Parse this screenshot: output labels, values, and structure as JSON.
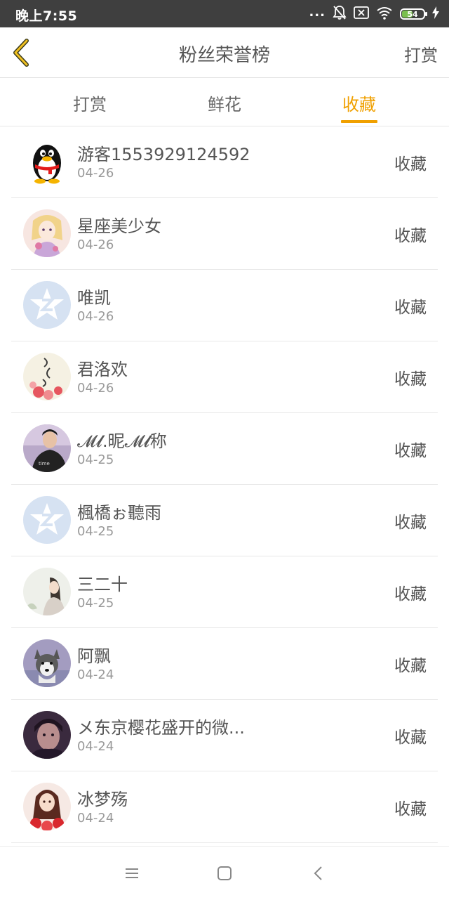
{
  "status_bar": {
    "time": "晚上7:55",
    "dots": "...",
    "battery_level": "54",
    "battery_percent": 54,
    "icons": [
      "bell-off-icon",
      "sim-x-icon",
      "wifi-icon",
      "battery-icon",
      "charging-icon"
    ]
  },
  "header": {
    "title": "粉丝荣誉榜",
    "right_action": "打赏",
    "back_icon": "chevron-left-icon"
  },
  "tabs": [
    {
      "label": "打赏",
      "active": false
    },
    {
      "label": "鲜花",
      "active": false
    },
    {
      "label": "收藏",
      "active": true
    }
  ],
  "accent_color": "#f0a000",
  "rows": [
    {
      "name": "游客1553929124592",
      "date": "04-26",
      "action": "收藏",
      "avatar": "qq-penguin-avatar"
    },
    {
      "name": "星座美少女",
      "date": "04-26",
      "action": "收藏",
      "avatar": "anime-girl-avatar"
    },
    {
      "name": "唯凯",
      "date": "04-26",
      "action": "收藏",
      "avatar": "default-star-avatar"
    },
    {
      "name": "君洛欢",
      "date": "04-26",
      "action": "收藏",
      "avatar": "flower-art-avatar"
    },
    {
      "name": "𝓜𝓵.昵𝓜𝓵称",
      "date": "04-25",
      "action": "收藏",
      "avatar": "boy-photo-avatar"
    },
    {
      "name": "楓橋ぉ聽雨",
      "date": "04-25",
      "action": "收藏",
      "avatar": "default-star-avatar"
    },
    {
      "name": "三二十",
      "date": "04-25",
      "action": "收藏",
      "avatar": "girl-sketch-avatar"
    },
    {
      "name": "阿飘",
      "date": "04-24",
      "action": "收藏",
      "avatar": "husky-dog-avatar"
    },
    {
      "name": "メ东京樱花盛开的微...",
      "date": "04-24",
      "action": "收藏",
      "avatar": "dark-portrait-avatar"
    },
    {
      "name": "冰梦殇",
      "date": "04-24",
      "action": "收藏",
      "avatar": "red-flower-girl-avatar"
    }
  ],
  "system_nav": [
    "menu-icon",
    "home-icon",
    "back-icon"
  ]
}
